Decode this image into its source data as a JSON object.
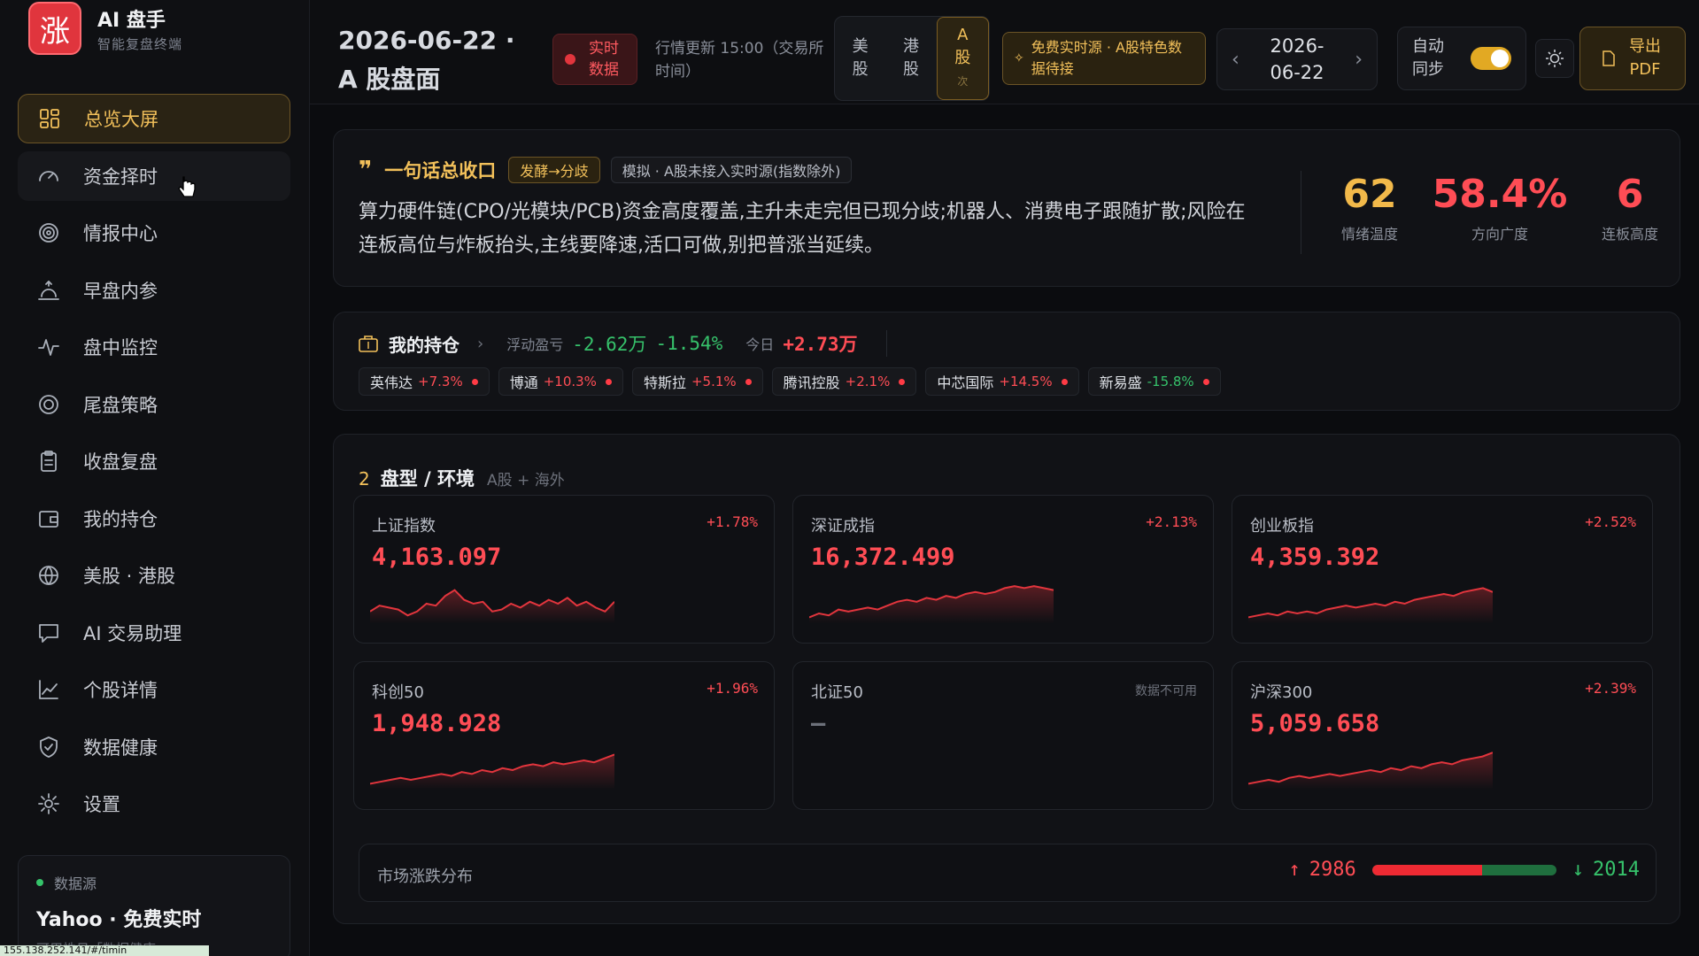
{
  "brand": {
    "logo_char": "涨",
    "title": "AI 盘手",
    "subtitle": "智能复盘终端"
  },
  "sidebar": {
    "items": [
      {
        "label": "总览大屏",
        "icon": "grid-icon",
        "state": "active"
      },
      {
        "label": "资金择时",
        "icon": "gauge-icon",
        "state": "hover"
      },
      {
        "label": "情报中心",
        "icon": "radar-icon",
        "state": ""
      },
      {
        "label": "早盘内参",
        "icon": "sunrise-icon",
        "state": ""
      },
      {
        "label": "盘中监控",
        "icon": "pulse-icon",
        "state": ""
      },
      {
        "label": "尾盘策略",
        "icon": "target-icon",
        "state": ""
      },
      {
        "label": "收盘复盘",
        "icon": "clipboard-icon",
        "state": ""
      },
      {
        "label": "我的持仓",
        "icon": "wallet-icon",
        "state": ""
      },
      {
        "label": "美股 · 港股",
        "icon": "globe-icon",
        "state": ""
      },
      {
        "label": "AI 交易助理",
        "icon": "chat-icon",
        "state": ""
      },
      {
        "label": "个股详情",
        "icon": "line-chart-icon",
        "state": ""
      },
      {
        "label": "数据健康",
        "icon": "shield-icon",
        "state": ""
      },
      {
        "label": "设置",
        "icon": "gear-icon",
        "state": ""
      }
    ],
    "datasource": {
      "label": "数据源",
      "value": "Yahoo · 免费实时",
      "note": "可用性见「数据健康」→"
    }
  },
  "status_url": "155.138.252.141/#/timin",
  "topbar": {
    "date_title": "2026-06-22 · A 股盘面",
    "live_badge": "实时数据",
    "update_text": "行情更新 15:00（交易所时间）",
    "market_tabs": [
      {
        "label": "美股",
        "active": false
      },
      {
        "label": "港股",
        "active": false
      },
      {
        "label": "A股",
        "sub": "次",
        "active": true
      }
    ],
    "source_warning": "免费实时源 · A股特色数据待接",
    "date_value": "2026-06-22",
    "auto_sync_label": "自动同步",
    "auto_sync_on": true,
    "export_label": "导出 PDF"
  },
  "summary": {
    "title": "一句话总收口",
    "tag_phase": "发酵→分歧",
    "tag_mode": "模拟 · A股未接入实时源(指数除外)",
    "text": "算力硬件链(CPO/光模块/PCB)资金高度覆盖,主升未走完但已现分歧;机器人、消费电子跟随扩散;风险在连板高位与炸板抬头,主线要降速,活口可做,别把普涨当延续。",
    "metrics": [
      {
        "value": "62",
        "label": "情绪温度",
        "color": "#f2b94a"
      },
      {
        "value": "58.4%",
        "label": "方向广度",
        "color": "#ff4d55"
      },
      {
        "value": "6",
        "label": "连板高度",
        "color": "#ff4d55"
      }
    ]
  },
  "holdings": {
    "title": "我的持仓",
    "floating_label": "浮动盈亏",
    "floating_value": "-2.62万",
    "floating_pct": "-1.54%",
    "today_label": "今日",
    "today_value": "+2.73万",
    "chips": [
      {
        "name": "英伟达",
        "pct": "+7.3%",
        "dir": "up"
      },
      {
        "name": "博通",
        "pct": "+10.3%",
        "dir": "up"
      },
      {
        "name": "特斯拉",
        "pct": "+5.1%",
        "dir": "up"
      },
      {
        "name": "腾讯控股",
        "pct": "+2.1%",
        "dir": "up"
      },
      {
        "name": "中芯国际",
        "pct": "+14.5%",
        "dir": "up"
      },
      {
        "name": "新易盛",
        "pct": "-15.8%",
        "dir": "down"
      }
    ]
  },
  "environment": {
    "num": "2",
    "title": "盘型 / 环境",
    "subtitle": "A股 + 海外",
    "indices": [
      {
        "name": "上证指数",
        "pct": "+1.78%",
        "value": "4,163.097",
        "available": true,
        "spark": [
          0.3,
          0.45,
          0.4,
          0.35,
          0.2,
          0.3,
          0.5,
          0.45,
          0.7,
          0.85,
          0.6,
          0.5,
          0.55,
          0.3,
          0.35,
          0.5,
          0.4,
          0.55,
          0.45,
          0.6,
          0.5,
          0.65,
          0.45,
          0.55,
          0.4,
          0.3,
          0.55
        ]
      },
      {
        "name": "深证成指",
        "pct": "+2.13%",
        "value": "16,372.499",
        "available": true,
        "spark": [
          0.15,
          0.25,
          0.2,
          0.35,
          0.3,
          0.35,
          0.4,
          0.35,
          0.45,
          0.55,
          0.6,
          0.55,
          0.65,
          0.6,
          0.7,
          0.65,
          0.75,
          0.8,
          0.75,
          0.8,
          0.9,
          0.95,
          0.9,
          0.95,
          0.9,
          0.85
        ]
      },
      {
        "name": "创业板指",
        "pct": "+2.52%",
        "value": "4,359.392",
        "available": true,
        "spark": [
          0.15,
          0.2,
          0.25,
          0.2,
          0.3,
          0.25,
          0.3,
          0.25,
          0.35,
          0.4,
          0.45,
          0.4,
          0.45,
          0.5,
          0.45,
          0.55,
          0.5,
          0.6,
          0.65,
          0.7,
          0.75,
          0.7,
          0.8,
          0.85,
          0.9,
          0.8
        ]
      },
      {
        "name": "科创50",
        "pct": "+1.96%",
        "value": "1,948.928",
        "available": true,
        "spark": [
          0.15,
          0.2,
          0.25,
          0.3,
          0.25,
          0.3,
          0.35,
          0.4,
          0.35,
          0.45,
          0.4,
          0.5,
          0.45,
          0.55,
          0.5,
          0.6,
          0.65,
          0.6,
          0.7,
          0.65,
          0.7,
          0.75,
          0.7,
          0.8,
          0.9
        ]
      },
      {
        "name": "北证50",
        "pct": "",
        "value": "—",
        "available": false,
        "na_text": "数据不可用",
        "spark": []
      },
      {
        "name": "沪深300",
        "pct": "+2.39%",
        "value": "5,059.658",
        "available": true,
        "spark": [
          0.15,
          0.2,
          0.25,
          0.2,
          0.3,
          0.35,
          0.3,
          0.35,
          0.4,
          0.35,
          0.4,
          0.45,
          0.5,
          0.45,
          0.55,
          0.5,
          0.6,
          0.55,
          0.65,
          0.7,
          0.65,
          0.75,
          0.8,
          0.85,
          0.95
        ]
      }
    ],
    "breadth": {
      "label": "市场涨跌分布",
      "up_count": "2986",
      "down_count": "2014",
      "up_ratio": 0.597
    }
  },
  "colors": {
    "up": "#ff4d55",
    "down": "#36c26b",
    "accent": "#f2c05a"
  }
}
